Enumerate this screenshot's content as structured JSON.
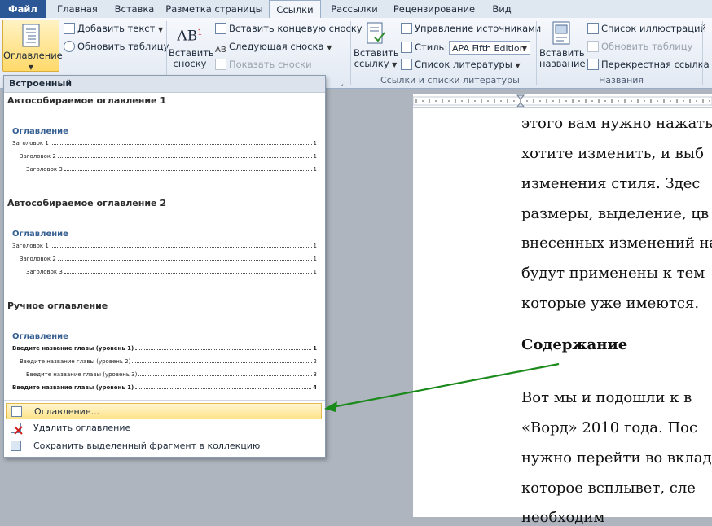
{
  "tabs": [
    "Файл",
    "Главная",
    "Вставка",
    "Разметка страницы",
    "Ссылки",
    "Рассылки",
    "Рецензирование",
    "Вид"
  ],
  "ribbon": {
    "toc_label": "Оглавление",
    "add_text": "Добавить текст",
    "update_table": "Обновить таблицу",
    "insert_footnote": [
      "Вставить",
      "сноску"
    ],
    "insert_endnote": "Вставить концевую сноску",
    "next_footnote": "Следующая сноска",
    "show_notes": "Показать сноски",
    "insert_citation": [
      "Вставить",
      "ссылку"
    ],
    "manage_sources": "Управление источниками",
    "style_label": "Стиль:",
    "style_value": "APA Fifth Edition",
    "bibliography": "Список литературы",
    "group_citations": "Ссылки и списки литературы",
    "insert_caption": [
      "Вставить",
      "название"
    ],
    "list_illustrations": "Список иллюстраций",
    "update_table2": "Обновить таблицу",
    "cross_ref": "Перекрестная ссылка",
    "group_captions": "Названия"
  },
  "menu": {
    "header": "Встроенный",
    "auto1": "Автособираемое оглавление 1",
    "auto2": "Автособираемое оглавление 2",
    "manual": "Ручное оглавление",
    "toc_heading": "Оглавление",
    "h1": "Заголовок 1",
    "h2": "Заголовок 2",
    "h3": "Заголовок 3",
    "page_num": "1",
    "manual_lines": [
      {
        "text": "Введите название главы (уровень 1)",
        "page": "1"
      },
      {
        "text": "Введите название главы (уровень 2)",
        "page": "2"
      },
      {
        "text": "Введите название главы (уровень 3)",
        "page": "3"
      },
      {
        "text": "Введите название главы (уровень 1)",
        "page": "4"
      }
    ],
    "item_toc": "Оглавление...",
    "item_remove": "Удалить оглавление",
    "item_save": "Сохранить выделенный фрагмент в коллекцию оглавлений..."
  },
  "doc": {
    "lines": [
      "этого вам нужно нажать",
      "хотите изменить, и выб",
      "изменения стиля.  Здес",
      "размеры, выделение, цв",
      "внесенных изменений на",
      "будут применены к тем",
      "которые уже имеются."
    ],
    "heading": "Содержание",
    "lines2": [
      "Вот мы и подошли к в",
      "«Ворд» 2010 года. Пос",
      "нужно перейти во вкладк",
      "которое всплывет, сле",
      "необходим"
    ]
  },
  "colors": {
    "accent": "#2b5797",
    "highlight": "#ffe48a",
    "arrow": "#1a8a1a",
    "toc_heading": "#365f91"
  }
}
